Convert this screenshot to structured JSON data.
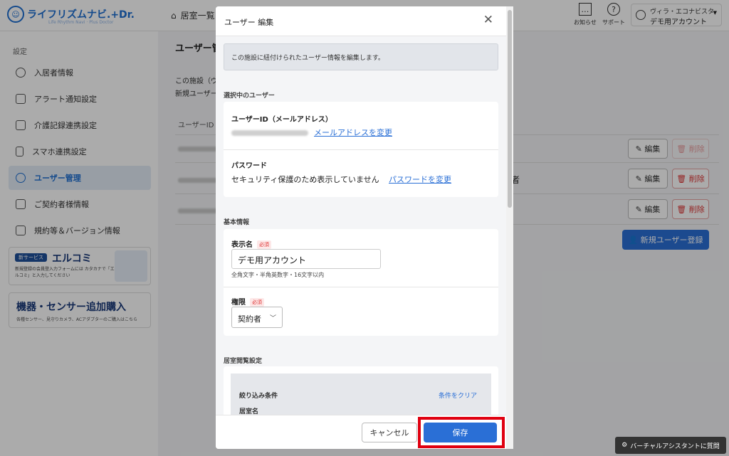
{
  "app": {
    "logo_text": "ライフリズムナビ.+Dr.",
    "logo_sub": "Life Rhythm Navi · Plus Doctor"
  },
  "header": {
    "breadcrumb": "居室一覧",
    "notice_label": "お知らせ",
    "support_label": "サポート",
    "account_facility": "ヴィラ・エコナビスタ",
    "account_name": "デモ用アカウント"
  },
  "sidebar": {
    "section_label": "設定",
    "items": [
      {
        "label": "入居者情報",
        "icon": "person-icon"
      },
      {
        "label": "アラート通知設定",
        "icon": "bell-icon"
      },
      {
        "label": "介護記録連携設定",
        "icon": "edit-icon"
      },
      {
        "label": "スマホ連携設定",
        "icon": "phone-icon"
      },
      {
        "label": "ユーザー管理",
        "icon": "users-icon",
        "active": true
      },
      {
        "label": "ご契約者様情報",
        "icon": "id-card-icon"
      },
      {
        "label": "規約等＆バージョン情報",
        "icon": "document-icon"
      }
    ],
    "banner1": {
      "tag": "新サービス",
      "title": "エルコミ",
      "desc": "新規登録の会員登入力フォームには カタカナで「エルコミ」と入力してください"
    },
    "banner2": {
      "title": "機器・センサー追加購入",
      "desc": "各種センサー、見守りカメラ、ACアダプターのご購入はこちら"
    }
  },
  "main": {
    "title": "ユーザー管",
    "desc_line1": "この施設（ヴ",
    "desc_line2": "新規ユーザー",
    "col_user_id": "ユーザーID",
    "edit_label": "編集",
    "delete_label": "削除",
    "role_peek": "者",
    "new_user_label": "新規ユーザー登録"
  },
  "modal": {
    "title": "ユーザー 編集",
    "info": "この施設に紐付けられたユーザー情報を編集します。",
    "selected_section": "選択中のユーザー",
    "userid_label": "ユーザーID（メールアドレス）",
    "change_email_link": "メールアドレスを変更",
    "password_label": "パスワード",
    "password_note": "セキュリティ保護のため表示していません",
    "change_password_link": "パスワードを変更",
    "basic_section": "基本情報",
    "display_name_label": "表示名",
    "required_badge": "必須",
    "display_name_value": "デモ用アカウント",
    "display_name_hint": "全角文字・半角英数字・16文字以内",
    "role_label": "権限",
    "role_value": "契約者",
    "room_section": "居室閲覧設定",
    "filter_label": "絞り込み条件",
    "clear_filter": "条件をクリア",
    "room_name_label": "居室名",
    "cancel_label": "キャンセル",
    "save_label": "保存"
  },
  "assistant_label": "バーチャルアシスタントに質問",
  "colors": {
    "accent": "#2a6fd6",
    "highlight": "#e00010",
    "danger": "#dd3333"
  }
}
